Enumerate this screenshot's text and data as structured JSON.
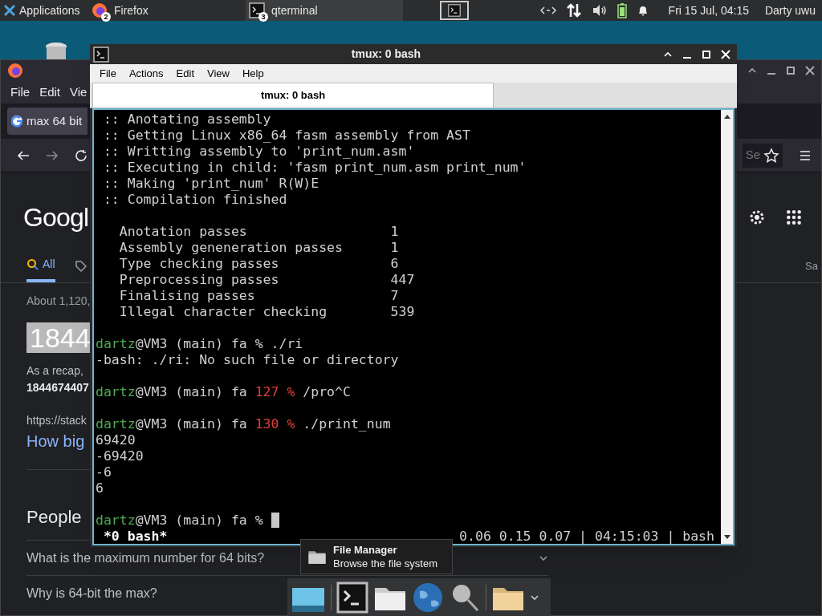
{
  "top_panel": {
    "apps_menu": "Applications",
    "tasks": [
      {
        "label": "Firefox",
        "badge": "2",
        "selected": false
      },
      {
        "label": "qterminal",
        "badge": "3",
        "selected": true
      }
    ],
    "clock": "Fri 15 Jul, 04:15",
    "user": "Darty uwu"
  },
  "browser": {
    "menu": [
      "File",
      "Edit",
      "Vie"
    ],
    "tab": "max 64 bit",
    "search_field": "Se",
    "logo": "Googl",
    "search_tabs": [
      {
        "label": "All",
        "selected": true
      }
    ],
    "right_label": "Sa",
    "result_count": "About 1,120,",
    "highlight": "1844",
    "snippet": "As a recap,",
    "snippet_bold": "1844674407",
    "url": "https://stack",
    "link": "How big",
    "section_title": "People",
    "questions": [
      "What is the maximum number for 64 bits?",
      "Why is 64-bit the max?"
    ]
  },
  "terminal": {
    "title": "tmux: 0 bash",
    "menu": [
      "File",
      "Actions",
      "Edit",
      "View",
      "Help"
    ],
    "tabs": [
      {
        "label": "tmux: 0 bash",
        "selected": true
      }
    ],
    "blocks": [
      [
        {
          "kind": "output",
          "text": " :: Anotating assembly"
        },
        {
          "kind": "output",
          "text": " :: Getting Linux x86_64 fasm assembly from AST"
        },
        {
          "kind": "output",
          "text": " :: Writting assembly to 'print_num.asm'"
        },
        {
          "kind": "output",
          "text": " :: Executing in child: 'fasm print_num.asm print_num'"
        },
        {
          "kind": "output",
          "text": " :: Making 'print_num' R(W)E"
        },
        {
          "kind": "output",
          "text": " :: Compilation finished"
        }
      ],
      [
        {
          "kind": "output",
          "text": "   Anotation passes                  1"
        },
        {
          "kind": "output",
          "text": "   Assembly geneneration passes      1"
        },
        {
          "kind": "output",
          "text": "   Type checking passes              6"
        },
        {
          "kind": "output",
          "text": "   Preprocessing passes              447"
        },
        {
          "kind": "output",
          "text": "   Finalising passes                 7"
        },
        {
          "kind": "output",
          "text": "   Illegal character checking        539"
        }
      ],
      [
        {
          "kind": "prompt",
          "user": "dartz",
          "host": "@VM3 (main) fa",
          "mark": "%",
          "error": false,
          "command": "./ri"
        },
        {
          "kind": "output",
          "text": "-bash: ./ri: No such file or directory"
        }
      ],
      [
        {
          "kind": "prompt",
          "user": "dartz",
          "host": "@VM3 (main) fa",
          "mark": "127 %",
          "error": true,
          "command": "/pro^C"
        }
      ],
      [
        {
          "kind": "prompt",
          "user": "dartz",
          "host": "@VM3 (main) fa",
          "mark": "130 %",
          "error": true,
          "command": "./print_num"
        },
        {
          "kind": "output",
          "text": "69420"
        },
        {
          "kind": "output",
          "text": "-69420"
        },
        {
          "kind": "output",
          "text": "-6"
        },
        {
          "kind": "output",
          "text": "6"
        }
      ],
      [
        {
          "kind": "prompt",
          "user": "dartz",
          "host": "@VM3 (main) fa",
          "mark": "%",
          "error": false,
          "cursor": true
        }
      ]
    ],
    "status": {
      "left": " *0 bash*",
      "right": "0.06 0.15 0.07 | 04:15:03 | bash"
    }
  },
  "tooltip": {
    "title": "File Manager",
    "subtitle": "Browse the file system"
  }
}
